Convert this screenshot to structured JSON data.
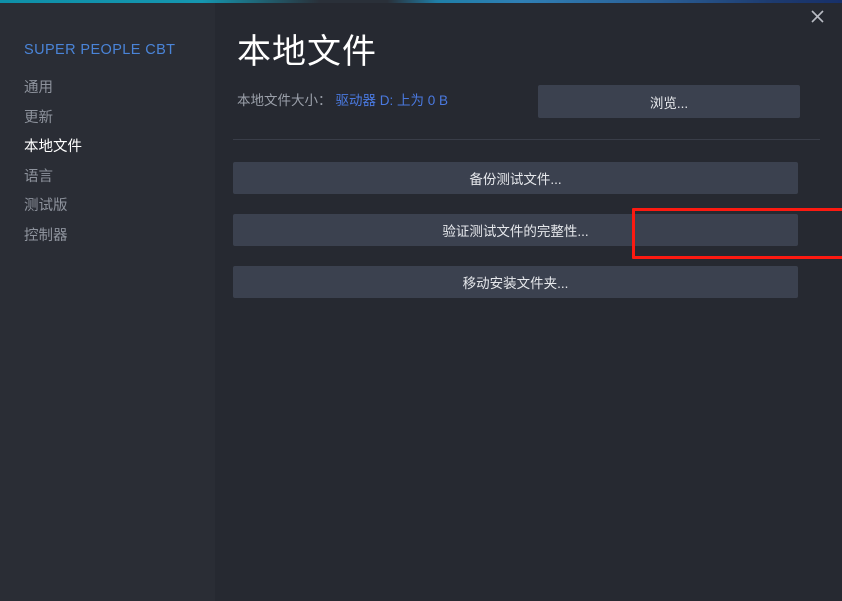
{
  "window": {
    "close_label": "✕"
  },
  "sidebar": {
    "title": "SUPER PEOPLE CBT",
    "items": [
      {
        "label": "通用",
        "selected": false
      },
      {
        "label": "更新",
        "selected": false
      },
      {
        "label": "本地文件",
        "selected": true
      },
      {
        "label": "语言",
        "selected": false
      },
      {
        "label": "测试版",
        "selected": false
      },
      {
        "label": "控制器",
        "selected": false
      }
    ]
  },
  "main": {
    "page_title": "本地文件",
    "size_label": "本地文件大小：",
    "size_value": "驱动器 D: 上为 0 B",
    "browse_label": "浏览...",
    "actions": [
      {
        "label": "备份测试文件...",
        "highlighted": false
      },
      {
        "label": "验证测试文件的完整性...",
        "highlighted": true
      },
      {
        "label": "移动安装文件夹...",
        "highlighted": false
      }
    ]
  },
  "colors": {
    "accent_blue": "#4a84d8",
    "link_blue": "#4a79e0",
    "button_bg": "#3b414f",
    "sidebar_bg": "#2a2d35",
    "content_bg": "#262931",
    "highlight_red": "#fc1a11",
    "top_accent_teal": "#0e8fa8"
  }
}
